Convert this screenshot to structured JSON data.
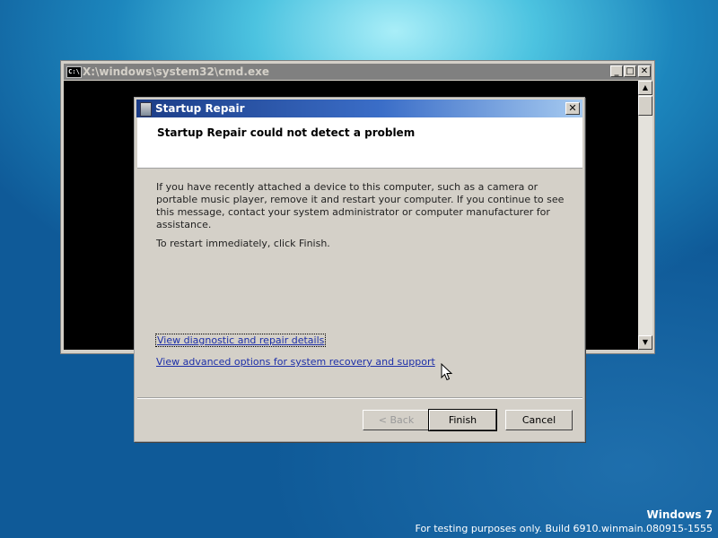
{
  "cmd": {
    "title": "X:\\windows\\system32\\cmd.exe",
    "icon_label": "C:\\",
    "minimize_glyph": "_",
    "maximize_glyph": "□",
    "close_glyph": "✕",
    "scroll_up_glyph": "▲",
    "scroll_down_glyph": "▼"
  },
  "dialog": {
    "title": "Startup Repair",
    "close_glyph": "✕",
    "header": "Startup Repair could not detect a problem",
    "body": "If you have recently attached a device to this computer, such as a camera or portable music player, remove it and restart your computer. If you continue to see this message, contact your system administrator or computer manufacturer for assistance.",
    "finish_hint": "To restart immediately, click Finish.",
    "link_diagnostic": "View diagnostic and repair details",
    "link_advanced": "View advanced options for system recovery and support",
    "buttons": {
      "back": "< Back",
      "finish": "Finish",
      "cancel": "Cancel"
    }
  },
  "watermark": {
    "product": "Windows 7",
    "build": "For testing purposes only. Build 6910.winmain.080915-1555"
  },
  "icons": {
    "cmd": "console-icon",
    "dialog": "startup-repair-icon",
    "cursor": "mouse-pointer-icon"
  }
}
